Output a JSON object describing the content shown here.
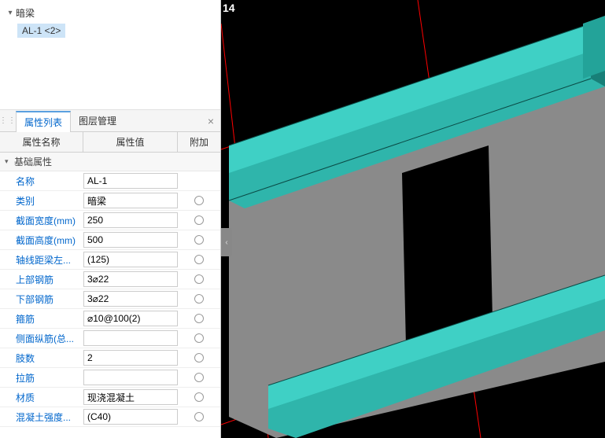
{
  "tree": {
    "root_label": "暗梁",
    "child_label": "AL-1 <2>"
  },
  "tabs": {
    "prop_list": "属性列表",
    "layer_mgr": "图层管理"
  },
  "grid_headers": {
    "name": "属性名称",
    "value": "属性值",
    "extra": "附加"
  },
  "group_basic": "基础属性",
  "props": [
    {
      "label": "名称",
      "value": "AL-1",
      "extra": false
    },
    {
      "label": "类别",
      "value": "暗梁",
      "extra": true
    },
    {
      "label": "截面宽度(mm)",
      "value": "250",
      "extra": true
    },
    {
      "label": "截面高度(mm)",
      "value": "500",
      "extra": true
    },
    {
      "label": "轴线距梁左...",
      "value": "(125)",
      "extra": true
    },
    {
      "label": "上部钢筋",
      "value": "3⌀22",
      "extra": true
    },
    {
      "label": "下部钢筋",
      "value": "3⌀22",
      "extra": true
    },
    {
      "label": "箍筋",
      "value": "⌀10@100(2)",
      "extra": true
    },
    {
      "label": "侧面纵筋(总...",
      "value": "",
      "extra": true
    },
    {
      "label": "肢数",
      "value": "2",
      "extra": true
    },
    {
      "label": "拉筋",
      "value": "",
      "extra": true
    },
    {
      "label": "材质",
      "value": "现浇混凝土",
      "extra": true
    },
    {
      "label": "混凝土强度...",
      "value": "(C40)",
      "extra": true
    }
  ],
  "viewport": {
    "axis_label": "14"
  }
}
